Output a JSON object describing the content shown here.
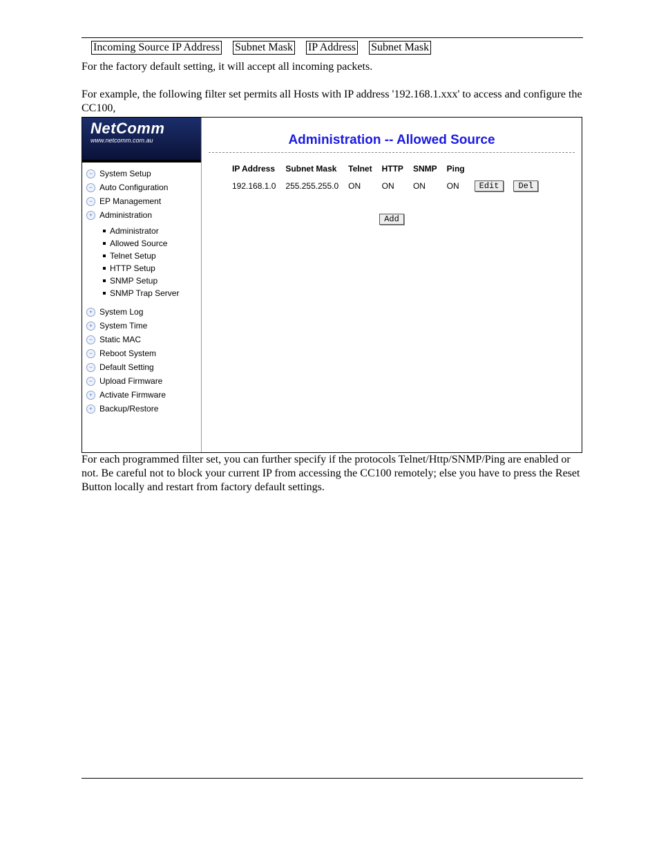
{
  "header_cells": [
    "Incoming Source IP Address",
    "Subnet Mask",
    "IP Address",
    "Subnet Mask"
  ],
  "para1": "For the factory default setting, it will accept all incoming packets.",
  "para2": "For example, the following filter set permits all Hosts with IP address '192.168.1.xxx' to access and configure the CC100,",
  "para3": "For each programmed filter set, you can further specify if the protocols Telnet/Http/SNMP/Ping are enabled or not. Be careful not to block your current IP from accessing the CC100 remotely; else you have to press the Reset Button locally and restart from factory default settings.",
  "logo": {
    "name": "NetComm",
    "url": "www.netcomm.com.au"
  },
  "nav": {
    "items": [
      {
        "label": "System Setup",
        "icon": "−"
      },
      {
        "label": "Auto Configuration",
        "icon": "−"
      },
      {
        "label": "EP Management",
        "icon": "−"
      },
      {
        "label": "Administration",
        "icon": "+",
        "children": [
          "Administrator",
          "Allowed Source",
          "Telnet Setup",
          "HTTP Setup",
          "SNMP Setup",
          "SNMP Trap Server"
        ]
      },
      {
        "label": "System Log",
        "icon": "+"
      },
      {
        "label": "System Time",
        "icon": "+"
      },
      {
        "label": "Static MAC",
        "icon": "−"
      },
      {
        "label": "Reboot System",
        "icon": "−"
      },
      {
        "label": "Default Setting",
        "icon": "−"
      },
      {
        "label": "Upload Firmware",
        "icon": "−"
      },
      {
        "label": "Activate Firmware",
        "icon": "+"
      },
      {
        "label": "Backup/Restore",
        "icon": "+"
      }
    ]
  },
  "main": {
    "title": "Administration -- Allowed Source",
    "columns": [
      "IP Address",
      "Subnet Mask",
      "Telnet",
      "HTTP",
      "SNMP",
      "Ping"
    ],
    "rows": [
      {
        "ip": "192.168.1.0",
        "mask": "255.255.255.0",
        "telnet": "ON",
        "http": "ON",
        "snmp": "ON",
        "ping": "ON"
      }
    ],
    "edit": "Edit",
    "del": "Del",
    "add": "Add"
  }
}
